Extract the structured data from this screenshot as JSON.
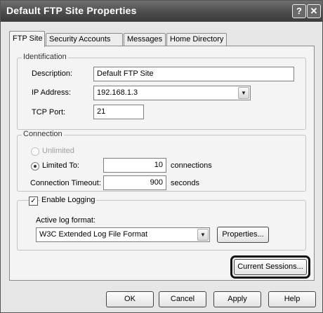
{
  "window": {
    "title": "Default FTP Site Properties",
    "help_glyph": "?",
    "close_glyph": "✕"
  },
  "tabs": [
    {
      "label": "FTP Site",
      "active": true
    },
    {
      "label": "Security Accounts"
    },
    {
      "label": "Messages"
    },
    {
      "label": "Home Directory"
    }
  ],
  "identification": {
    "legend": "Identification",
    "description_label": "Description:",
    "description_value": "Default FTP Site",
    "ip_label": "IP Address:",
    "ip_value": "192.168.1.3",
    "port_label": "TCP Port:",
    "port_value": "21"
  },
  "connection": {
    "legend": "Connection",
    "unlimited_label": "Unlimited",
    "limited_label": "Limited To:",
    "limited_value": "10",
    "limited_unit": "connections",
    "timeout_label": "Connection Timeout:",
    "timeout_value": "900",
    "timeout_unit": "seconds"
  },
  "logging": {
    "enable_label": "Enable Logging",
    "enabled": true,
    "format_label": "Active log format:",
    "format_value": "W3C Extended Log File Format",
    "properties_button": "Properties..."
  },
  "current_sessions_button": "Current Sessions...",
  "footer": {
    "ok": "OK",
    "cancel": "Cancel",
    "apply": "Apply",
    "help": "Help"
  },
  "icons": {
    "dropdown": "▼",
    "check": "✓"
  }
}
